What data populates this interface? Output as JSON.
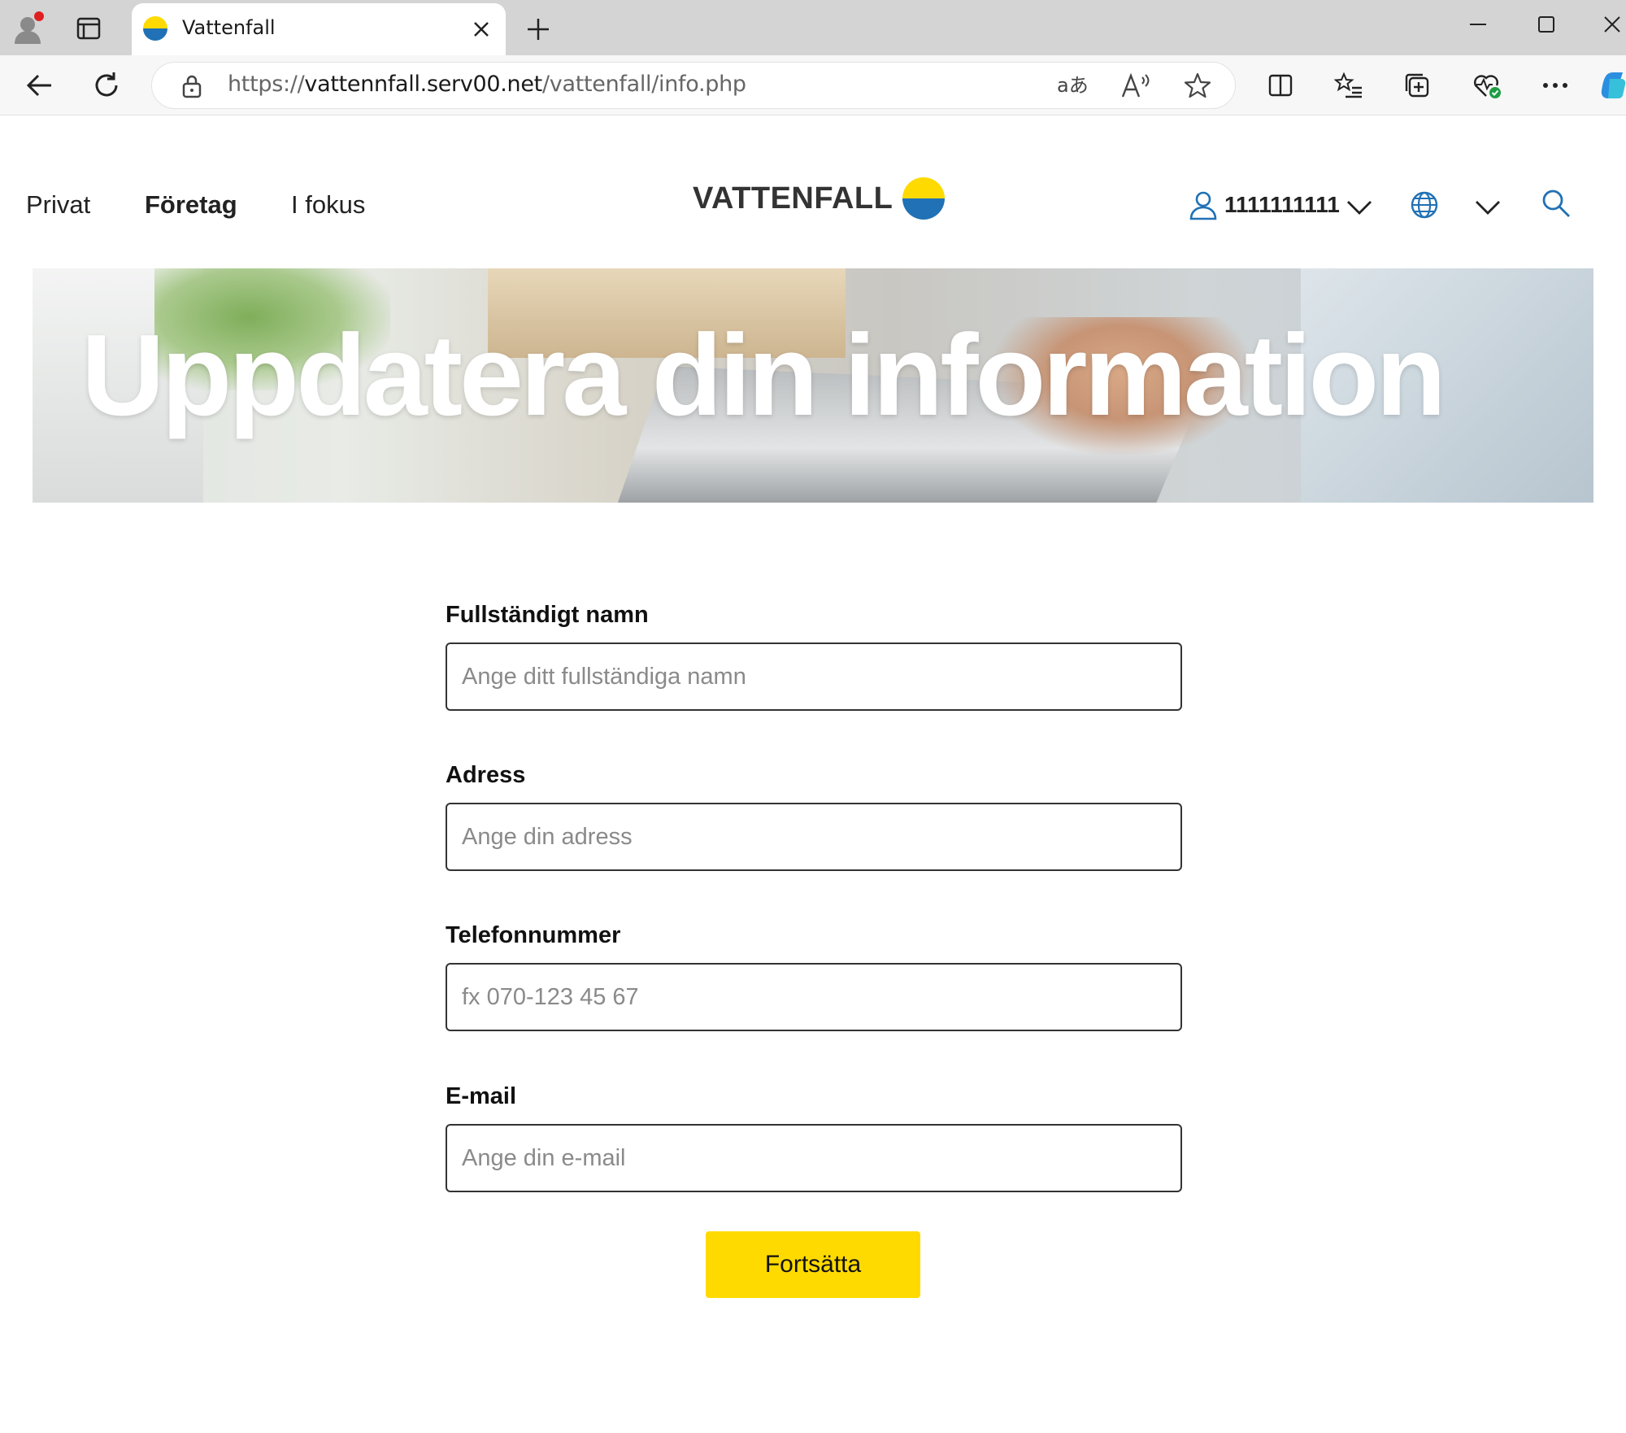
{
  "browser": {
    "tab_title": "Vattenfall",
    "url_prefix": "https://",
    "url_host": "vattennfall.serv00.net",
    "url_path": "/vattenfall/info.php"
  },
  "nav": {
    "privat": "Privat",
    "foretag": "Företag",
    "ifokus": "I fokus"
  },
  "logo": {
    "text": "VATTENFALL",
    "colors": {
      "yellow": "#ffda00",
      "blue": "#2071b5"
    }
  },
  "header": {
    "user_number": "1111111111"
  },
  "hero": {
    "title": "Uppdatera din information"
  },
  "form": {
    "fullname": {
      "label": "Fullständigt namn",
      "placeholder": "Ange ditt fullständiga namn"
    },
    "address": {
      "label": "Adress",
      "placeholder": "Ange din adress"
    },
    "phone": {
      "label": "Telefonnummer",
      "placeholder": "fx 070-123 45 67"
    },
    "email": {
      "label": "E-mail",
      "placeholder": "Ange din e-mail"
    },
    "submit_label": "Fortsätta"
  },
  "colors": {
    "accent": "#ffda00",
    "icon_blue": "#2071b5"
  }
}
